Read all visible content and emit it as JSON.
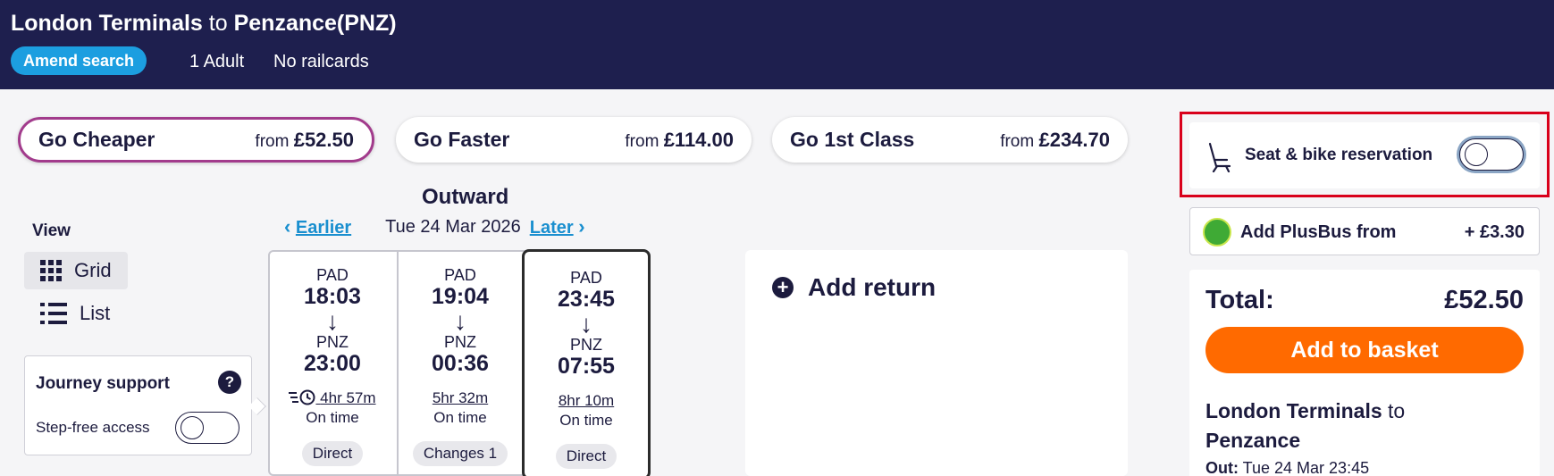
{
  "header": {
    "origin": "London Terminals",
    "connector": "to",
    "destination": "Penzance(PNZ)",
    "amend_label": "Amend search",
    "passengers": "1 Adult",
    "railcards": "No railcards"
  },
  "fare_tabs": [
    {
      "label": "Go Cheaper",
      "from": "from",
      "price": "£52.50",
      "active": true
    },
    {
      "label": "Go Faster",
      "from": "from",
      "price": "£114.00",
      "active": false
    },
    {
      "label": "Go 1st Class",
      "from": "from",
      "price": "£234.70",
      "active": false
    }
  ],
  "view": {
    "title": "View",
    "options": [
      {
        "label": "Grid",
        "icon": "grid-icon",
        "active": true
      },
      {
        "label": "List",
        "icon": "list-icon",
        "active": false
      }
    ]
  },
  "journey_support": {
    "title": "Journey support",
    "help": "?",
    "step_free_label": "Step-free access",
    "step_free_on": false
  },
  "outward": {
    "title": "Outward",
    "earlier": "Earlier",
    "date": "Tue 24 Mar 2026",
    "later": "Later",
    "services": [
      {
        "from": "PAD",
        "depart": "18:03",
        "to": "PNZ",
        "arrive": "23:00",
        "duration": "4hr 57m",
        "status": "On time",
        "changes": "Direct",
        "fast_icon": true,
        "selected": false
      },
      {
        "from": "PAD",
        "depart": "19:04",
        "to": "PNZ",
        "arrive": "00:36",
        "duration": "5hr 32m",
        "status": "On time",
        "changes": "Changes 1",
        "fast_icon": false,
        "selected": false
      },
      {
        "from": "PAD",
        "depart": "23:45",
        "to": "PNZ",
        "arrive": "07:55",
        "duration": "8hr 10m",
        "status": "On time",
        "changes": "Direct",
        "fast_icon": false,
        "selected": true
      }
    ]
  },
  "return": {
    "label": "Add return"
  },
  "seat_reservation": {
    "label": "Seat & bike reservation",
    "on": false
  },
  "plusbus": {
    "label": "Add PlusBus from",
    "price": "+ £3.30"
  },
  "summary": {
    "total_label": "Total:",
    "total_value": "£52.50",
    "basket_label": "Add to basket",
    "origin": "London Terminals",
    "connector": "to",
    "destination": "Penzance",
    "out_label": "Out:",
    "out_value": "Tue 24 Mar 23:45"
  },
  "colors": {
    "header_bg": "#1e1f4e",
    "accent_blue": "#1c9ee0",
    "active_tab_border": "#a23b8c",
    "basket_orange": "#ff6a00",
    "highlight_red": "#d9001b"
  }
}
